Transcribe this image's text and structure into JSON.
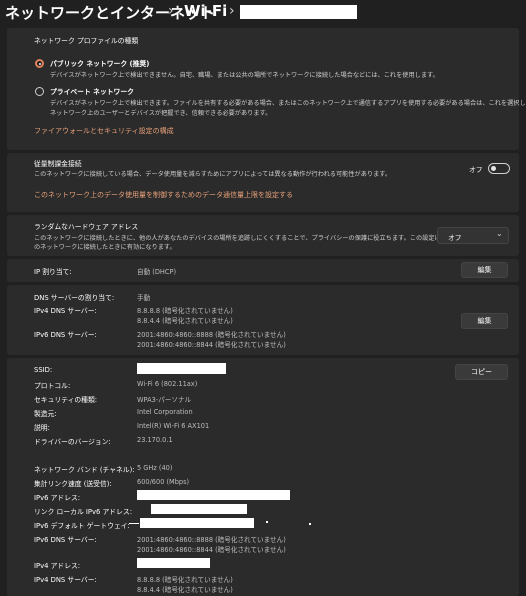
{
  "breadcrumb": {
    "network": "ネットワークとインターネット",
    "wifi": "Wi-Fi",
    "separator": "›"
  },
  "profile": {
    "title": "ネットワーク プロファイルの種類",
    "public_label": "パブリック ネットワーク (推奨)",
    "public_desc": "デバイスがネットワーク上で検出できません。自宅、職場、または公共の場所でネットワークに接続した場合などには、これを使用します。",
    "private_label": "プライベート ネットワーク",
    "private_desc1": "デバイスがネットワーク上で検出できます。ファイルを共有する必要がある場合、またはこのネットワーク上で通信するアプリを使用する必要がある場合は、これを選択します。",
    "private_desc2": "ネットワーク上のユーザーとデバイスが把握でき、信頼できる必要があります。",
    "firewall_link": "ファイアウォールとセキュリティ設定の構成"
  },
  "metered": {
    "title": "従量制課金接続",
    "desc": "このネットワークに接続している場合、データ使用量を減らすためにアプリによっては異なる動作が行われる可能性があります。",
    "toggle_label": "オフ",
    "link": "このネットワーク上のデータ使用量を制御するためのデータ通信量上限を設定する"
  },
  "random_hw": {
    "title": "ランダムなハードウェア アドレス",
    "desc1": "このネットワークに接続したときに、他の人があなたのデバイスの場所を追跡しにくくすることで、プライバシーの保護に役立ちます。この設定は、次にこ",
    "desc2": "のネットワークに接続したときに有効になります。",
    "select_value": "オフ",
    "select_chevron": "⌄"
  },
  "ip": {
    "label": "IP 割り当て:",
    "value": "自動 (DHCP)",
    "edit_button": "編集"
  },
  "dns": {
    "label": "DNS サーバーの割り当て:",
    "value": "手動",
    "ipv4_label": "IPv4 DNS サーバー:",
    "ipv4_1": "8.8.8.8 (暗号化されていません)",
    "ipv4_2": "8.8.4.4 (暗号化されていません)",
    "ipv6_label": "IPv6 DNS サーバー:",
    "ipv6_1": "2001:4860:4860::8888 (暗号化されていません)",
    "ipv6_2": "2001:4860:4860::8844 (暗号化されていません)",
    "edit_button": "編集"
  },
  "details": {
    "copy_button": "コピー",
    "rows": [
      {
        "label": "SSID:",
        "value": ""
      },
      {
        "label": "プロトコル:",
        "value": "Wi-Fi 6 (802.11ax)"
      },
      {
        "label": "セキュリティの種類:",
        "value": "WPA3-パーソナル"
      },
      {
        "label": "製造元:",
        "value": "Intel Corporation"
      },
      {
        "label": "説明:",
        "value": "Intel(R) Wi-Fi 6 AX101"
      },
      {
        "label": "ドライバーのバージョン:",
        "value": "23.170.0.1"
      },
      {
        "label": "ネットワーク バンド (チャネル):",
        "value": "5 GHz (40)"
      },
      {
        "label": "集計リンク速度 (送受信):",
        "value": "600/600 (Mbps)"
      },
      {
        "label": "IPv6 アドレス:",
        "value": ""
      },
      {
        "label": "リンク ローカル IPv6 アドレス:",
        "value": ""
      },
      {
        "label": "IPv6 デフォルト ゲートウェイ:",
        "value": ""
      },
      {
        "label": "IPv6 DNS サーバー:",
        "value1": "2001:4860:4860::8888 (暗号化されていません)",
        "value2": "2001:4860:4860::8844 (暗号化されていません)"
      },
      {
        "label": "IPv4 アドレス:",
        "value": ""
      },
      {
        "label": "IPv4 DNS サーバー:",
        "value1": "8.8.8.8 (暗号化されていません)",
        "value2": "8.8.4.4 (暗号化されていません)"
      }
    ]
  }
}
